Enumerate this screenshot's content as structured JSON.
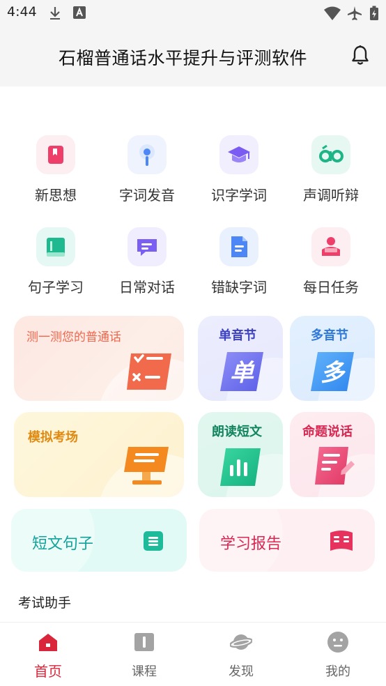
{
  "status_bar": {
    "time": "4:44"
  },
  "header": {
    "title": "石榴普通话水平提升与评测软件"
  },
  "features": [
    {
      "label": "新思想",
      "icon": "bookmark-book-icon"
    },
    {
      "label": "字词发音",
      "icon": "microphone-icon"
    },
    {
      "label": "识字学词",
      "icon": "graduation-cap-icon"
    },
    {
      "label": "声调听辩",
      "icon": "tone-ao-icon"
    },
    {
      "label": "句子学习",
      "icon": "book-icon"
    },
    {
      "label": "日常对话",
      "icon": "chat-bubble-icon"
    },
    {
      "label": "错缺字词",
      "icon": "document-icon"
    },
    {
      "label": "每日任务",
      "icon": "reader-person-icon"
    }
  ],
  "cards": {
    "test": {
      "title": "测一测您的普通话"
    },
    "single": {
      "title": "单音节",
      "glyph": "单"
    },
    "multi": {
      "title": "多音节",
      "glyph": "多"
    },
    "exam": {
      "title": "模拟考场"
    },
    "reading": {
      "title": "朗读短文"
    },
    "speech": {
      "title": "命题说话"
    },
    "sentences": {
      "title": "短文句子"
    },
    "report": {
      "title": "学习报告"
    }
  },
  "section": {
    "label": "考试助手"
  },
  "bottom_nav": [
    {
      "label": "首页",
      "icon": "home-icon",
      "active": true
    },
    {
      "label": "课程",
      "icon": "book-icon",
      "active": false
    },
    {
      "label": "发现",
      "icon": "planet-icon",
      "active": false
    },
    {
      "label": "我的",
      "icon": "smiley-face-icon",
      "active": false
    }
  ],
  "colors": {
    "accent": "#d9263b",
    "nav_inactive": "#999999"
  }
}
